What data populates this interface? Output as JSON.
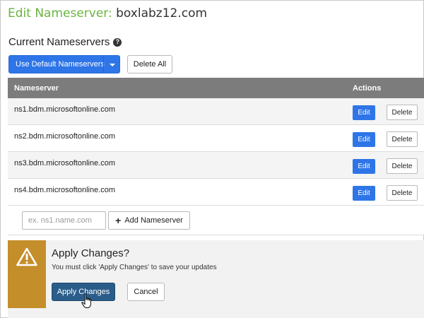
{
  "header": {
    "title_label": "Edit Nameserver:",
    "domain": "boxlabz12.com"
  },
  "section": {
    "title": "Current Nameservers",
    "help_icon": "question-circle-icon"
  },
  "toolbar": {
    "use_default_label": "Use Default Nameservers",
    "delete_all_label": "Delete All"
  },
  "table": {
    "columns": [
      "Nameserver",
      "Actions"
    ],
    "rows": [
      {
        "nameserver": "ns1.bdm.microsoftonline.com",
        "edit_label": "Edit",
        "delete_label": "Delete"
      },
      {
        "nameserver": "ns2.bdm.microsoftonline.com",
        "edit_label": "Edit",
        "delete_label": "Delete"
      },
      {
        "nameserver": "ns3.bdm.microsoftonline.com",
        "edit_label": "Edit",
        "delete_label": "Delete"
      },
      {
        "nameserver": "ns4.bdm.microsoftonline.com",
        "edit_label": "Edit",
        "delete_label": "Delete"
      }
    ]
  },
  "add": {
    "placeholder": "ex. ns1.name.com",
    "value": "",
    "button_label": "Add Nameserver"
  },
  "apply": {
    "title": "Apply Changes?",
    "message": "You must click 'Apply Changes' to save your updates",
    "apply_label": "Apply Changes",
    "cancel_label": "Cancel"
  },
  "colors": {
    "brand_green": "#6ab43e",
    "primary_blue": "#2e75e8",
    "apply_blue": "#2a5d8a",
    "warning": "#c48e2a",
    "header_gray": "#7c7c7c"
  }
}
